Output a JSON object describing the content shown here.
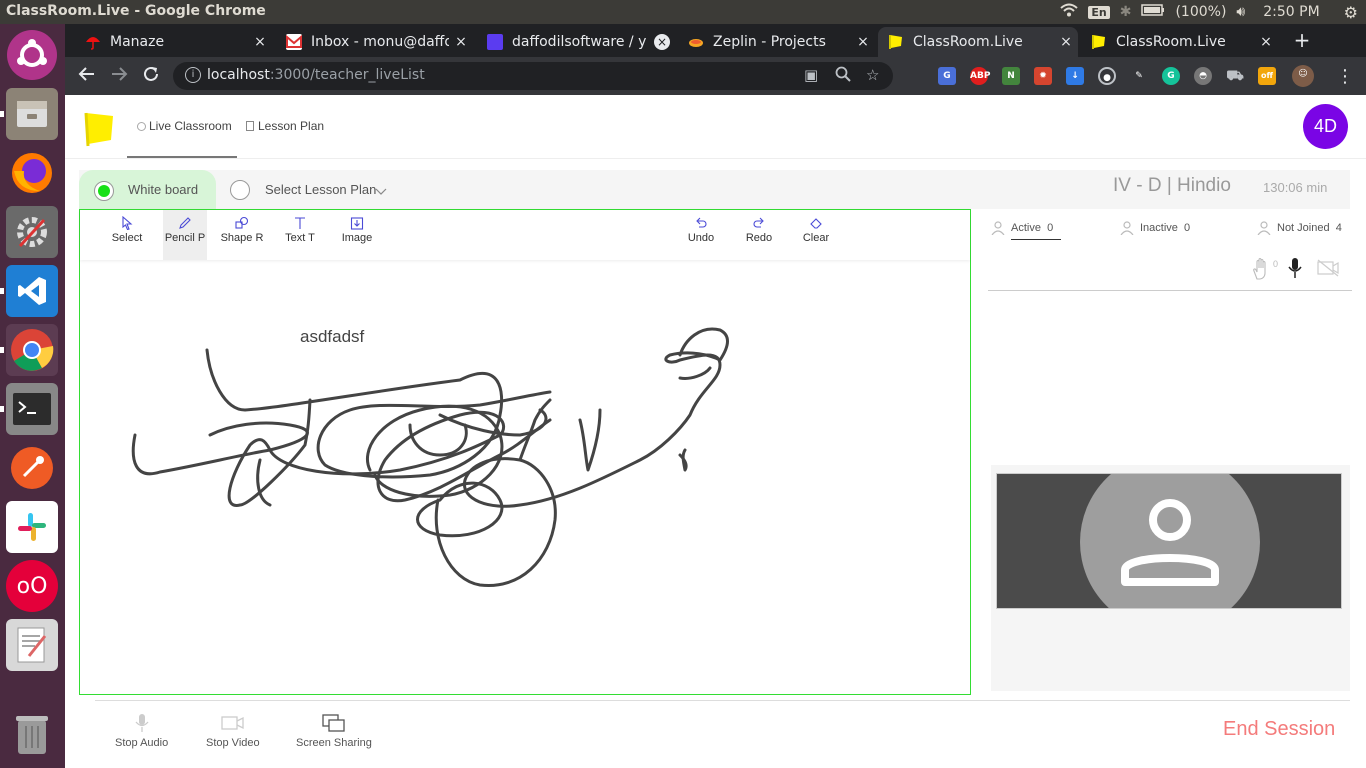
{
  "window": {
    "title": "ClassRoom.Live - Google Chrome",
    "tray": {
      "lang": "En",
      "battery": "(100%)",
      "time": "2:50 PM"
    }
  },
  "launcher": {
    "apps": [
      "ubuntu-icon",
      "files-icon",
      "firefox-icon",
      "settings-icon",
      "vscode-icon",
      "chrome-icon",
      "terminal-icon",
      "postman-icon",
      "slack-icon",
      "oo-icon",
      "text-editor-icon",
      "trash-icon"
    ]
  },
  "browser": {
    "tabs": [
      {
        "label": "Manaze",
        "close": "×"
      },
      {
        "label": "Inbox - monu@daffo",
        "close": "×"
      },
      {
        "label": "daffodilsoftware / y",
        "close": "×"
      },
      {
        "label": "Zeplin - Projects",
        "close": "×"
      },
      {
        "label": "ClassRoom.Live",
        "close": "×"
      },
      {
        "label": "ClassRoom.Live",
        "close": "×"
      }
    ],
    "new_tab": "+",
    "url_host": "localhost",
    "url_path": ":3000/teacher_liveList"
  },
  "app": {
    "nav": {
      "live_classroom": "Live Classroom",
      "lesson_plan": "Lesson Plan"
    },
    "avatar": "4D",
    "white_board": "White board",
    "select_lesson_plan": "Select Lesson Plan",
    "class_info": "IV - D | Hindio",
    "duration": "130:06 min",
    "tools": {
      "select": "Select",
      "pencil": "Pencil P",
      "shape": "Shape R",
      "text": "Text T",
      "image": "Image",
      "undo": "Undo",
      "redo": "Redo",
      "clear": "Clear"
    },
    "canvas_text": "asdfadsf",
    "status": {
      "active_label": "Active",
      "active_count": "0",
      "inactive_label": "Inactive",
      "inactive_count": "0",
      "not_joined_label": "Not Joined",
      "not_joined_count": "4",
      "hand_count": "0"
    },
    "bottom": {
      "stop_audio": "Stop Audio",
      "stop_video": "Stop Video",
      "screen_sharing": "Screen Sharing",
      "end_session": "End Session"
    }
  },
  "colors": {
    "accent_green": "#18e018",
    "avatar_purple": "#7a05e5",
    "end_session": "#f47b7b",
    "logo_yellow": "#ffee00"
  }
}
